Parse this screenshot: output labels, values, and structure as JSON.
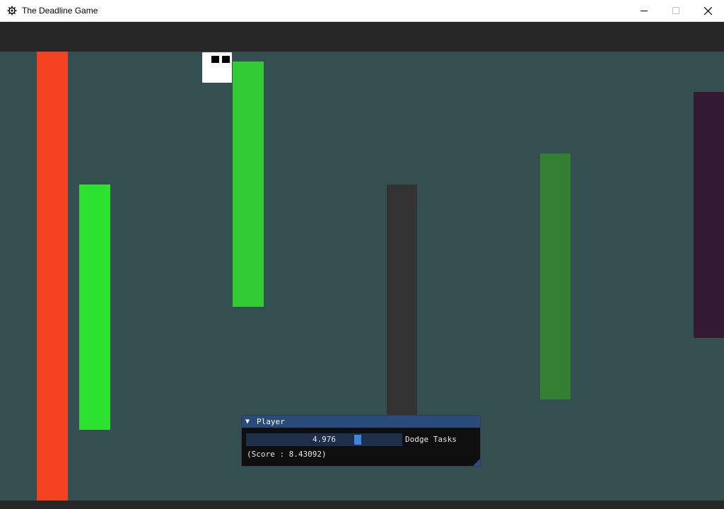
{
  "window": {
    "title": "The Deadline Game",
    "icon": "gear-app-icon",
    "controls": [
      "minimize-icon",
      "maximize-icon",
      "close-icon"
    ]
  },
  "game": {
    "background_color": "#344f4f",
    "player": {
      "color": "#ffffff",
      "eye_color": "#000000"
    },
    "obstacles": [
      {
        "color": "#f44220"
      },
      {
        "color": "#2ee330"
      },
      {
        "color": "#33cb33"
      },
      {
        "color": "#333333"
      },
      {
        "color": "#338033"
      },
      {
        "color": "#331933"
      }
    ]
  },
  "panel": {
    "collapse_icon": "triangle-down-icon",
    "title": "Player",
    "slider": {
      "value": "4.976",
      "fraction": 0.73,
      "label": "Dodge Tasks"
    },
    "score_text": "(Score : 8.43092)",
    "accent_color": "#3d85e0",
    "header_color": "#294a7a"
  }
}
